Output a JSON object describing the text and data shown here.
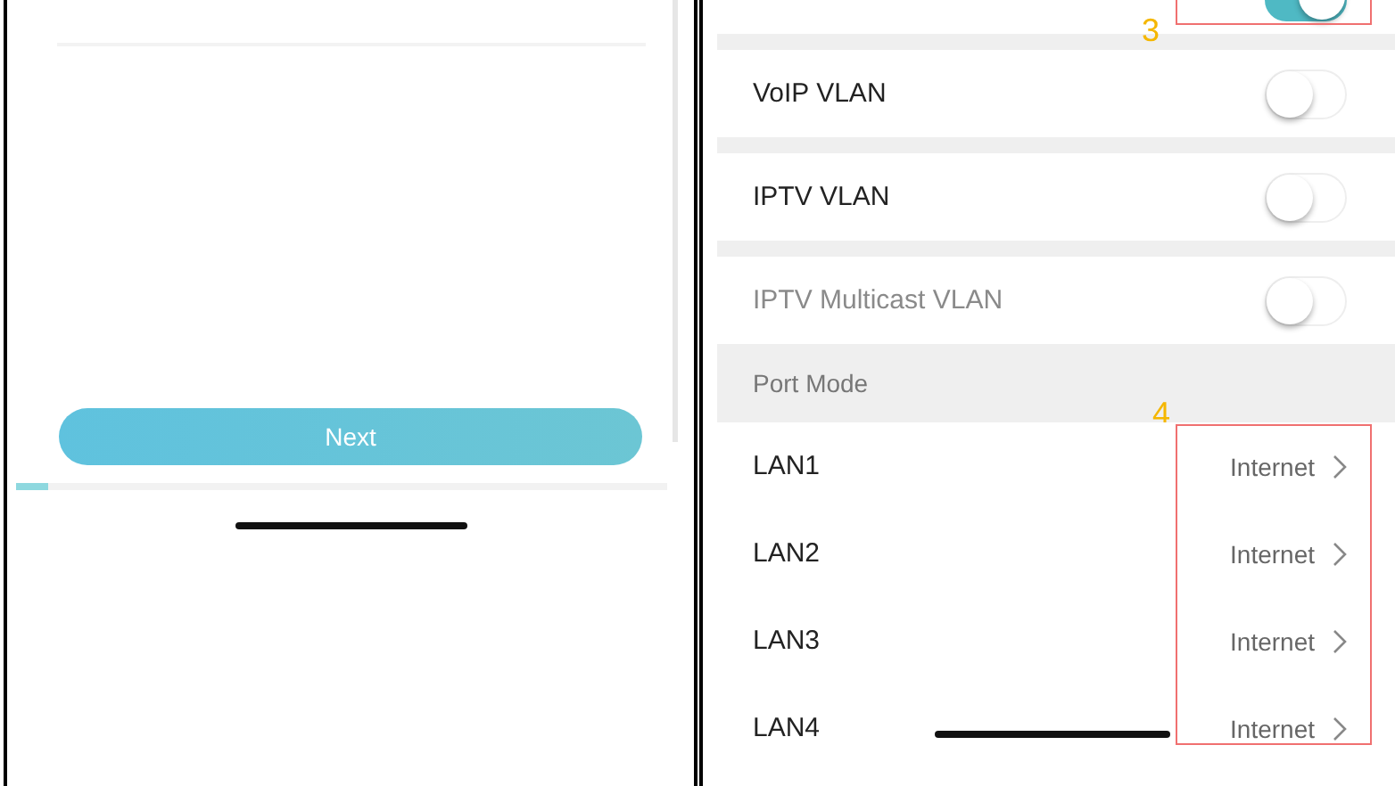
{
  "left_screen": {
    "next_button": "Next",
    "progress": {
      "level": 0.05
    }
  },
  "right_screen": {
    "top_toggle": {
      "on": true
    },
    "vlan_rows": [
      {
        "label": "VoIP VLAN",
        "on": false,
        "disabled": false
      },
      {
        "label": "IPTV VLAN",
        "on": false,
        "disabled": false
      },
      {
        "label": "IPTV Multicast VLAN",
        "on": false,
        "disabled": true
      }
    ],
    "section_header": "Port Mode",
    "port_rows": [
      {
        "label": "LAN1",
        "value": "Internet"
      },
      {
        "label": "LAN2",
        "value": "Internet"
      },
      {
        "label": "LAN3",
        "value": "Internet"
      },
      {
        "label": "LAN4",
        "value": "Internet"
      }
    ]
  },
  "annotations": [
    {
      "number": "3"
    },
    {
      "number": "4"
    }
  ]
}
